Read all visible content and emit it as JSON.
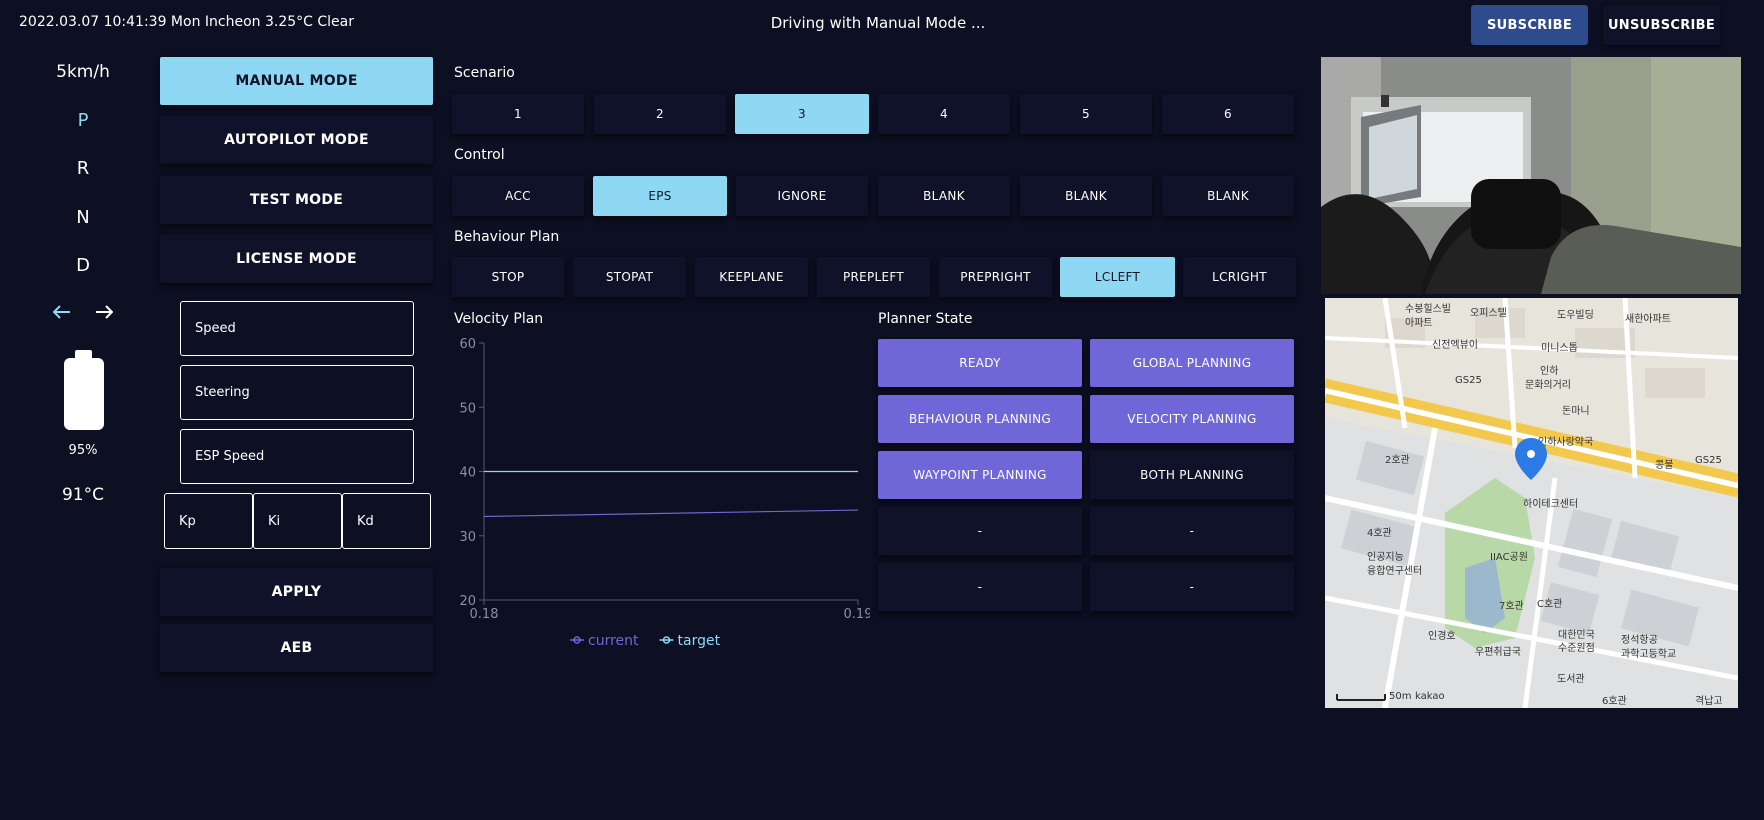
{
  "header": {
    "info": "2022.03.07 10:41:39 Mon Incheon 3.25°C Clear",
    "title": "Driving with Manual Mode ...",
    "subscribe": "SUBSCRIBE",
    "unsubscribe": "UNSUBSCRIBE"
  },
  "status": {
    "speed": "5km/h",
    "gears": [
      "P",
      "R",
      "N",
      "D"
    ],
    "active_gear": "P",
    "battery_percent": "95%",
    "battery_level": 0.95,
    "temperature": "91°C",
    "arrow_left_icon": "arrow-left-icon",
    "arrow_right_icon": "arrow-right-icon"
  },
  "modes": {
    "items": [
      "MANUAL MODE",
      "AUTOPILOT MODE",
      "TEST MODE",
      "LICENSE MODE"
    ],
    "active": "MANUAL MODE"
  },
  "params": {
    "speed_placeholder": "Speed",
    "steering_placeholder": "Steering",
    "esp_speed_placeholder": "ESP Speed",
    "kp_placeholder": "Kp",
    "ki_placeholder": "Ki",
    "kd_placeholder": "Kd",
    "apply": "APPLY",
    "aeb": "AEB"
  },
  "scenario": {
    "title": "Scenario",
    "items": [
      "1",
      "2",
      "3",
      "4",
      "5",
      "6"
    ],
    "active": "3"
  },
  "control": {
    "title": "Control",
    "items": [
      "ACC",
      "EPS",
      "IGNORE",
      "BLANK",
      "BLANK",
      "BLANK"
    ],
    "active_index": 1
  },
  "behaviour": {
    "title": "Behaviour Plan",
    "items": [
      "STOP",
      "STOPAT",
      "KEEPLANE",
      "PREPLEFT",
      "PREPRIGHT",
      "LCLEFT",
      "LCRIGHT"
    ],
    "active": "LCLEFT"
  },
  "velocity_plan": {
    "title": "Velocity Plan"
  },
  "chart_data": {
    "type": "line",
    "x": [
      0.18,
      0.19
    ],
    "xlim": [
      0.18,
      0.19
    ],
    "ylim": [
      20,
      60
    ],
    "y_ticks": [
      20,
      30,
      40,
      50,
      60
    ],
    "x_ticks": [
      "0.18",
      "0.19"
    ],
    "series": [
      {
        "name": "current",
        "x": [
          0.18,
          0.19
        ],
        "values": [
          33,
          34
        ],
        "color": "#6f67d8"
      },
      {
        "name": "target",
        "x": [
          0.18,
          0.19
        ],
        "values": [
          40,
          40
        ],
        "color": "#8fd8f3"
      }
    ],
    "legend": "bottom-center",
    "grid": false
  },
  "planner": {
    "title": "Planner State",
    "items": [
      {
        "label": "READY",
        "on": true
      },
      {
        "label": "GLOBAL PLANNING",
        "on": true
      },
      {
        "label": "BEHAVIOUR PLANNING",
        "on": true
      },
      {
        "label": "VELOCITY PLANNING",
        "on": true
      },
      {
        "label": "WAYPOINT PLANNING",
        "on": true
      },
      {
        "label": "BOTH PLANNING",
        "on": false
      },
      {
        "label": "-",
        "on": false
      },
      {
        "label": "-",
        "on": false
      },
      {
        "label": "-",
        "on": false
      },
      {
        "label": "-",
        "on": false
      }
    ]
  },
  "map": {
    "labels": [
      "수봉힐스빌",
      "아파트",
      "오피스텔",
      "도우빌딩",
      "새한아파트",
      "신전엑뷰이",
      "미니스톱",
      "GS25",
      "인하",
      "문화의거리",
      "돈마니",
      "인하사랑약국",
      "2호관",
      "콩불",
      "GS25",
      "하이테크센터",
      "4호관",
      "인공지능",
      "융합연구센터",
      "IIAC공원",
      "7호관",
      "C호관",
      "인경호",
      "우편취급국",
      "대한민국",
      "수준원점",
      "정석항공",
      "과학고등학교",
      "도서관",
      "6호관",
      "격납고",
      "50m",
      "kakao"
    ],
    "pin_icon": "map-pin-icon"
  },
  "colors": {
    "background": "#0d0f22",
    "panel": "#10122a",
    "accent": "#8fd8f3",
    "planner_on": "#6f67d8",
    "subscribe": "#2e4b8e"
  }
}
